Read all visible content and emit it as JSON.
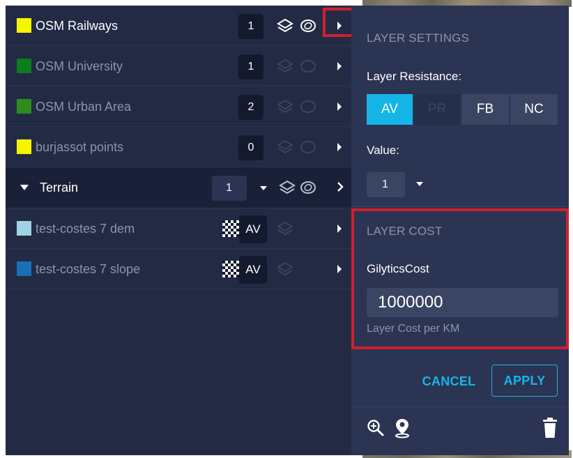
{
  "colors": {
    "accent": "#16b5e8",
    "panel_bg": "#2b3452",
    "list_bg": "#232a44",
    "highlight": "#d0202f"
  },
  "layers": [
    {
      "name": "OSM Railways",
      "color": "#f5f500",
      "count": "1",
      "active": true
    },
    {
      "name": "OSM University",
      "color": "#0e7d1e",
      "count": "1",
      "active": false
    },
    {
      "name": "OSM Urban Area",
      "color": "#2e8b1e",
      "count": "2",
      "active": false
    },
    {
      "name": "burjassot points",
      "color": "#f5f500",
      "count": "0",
      "active": false
    }
  ],
  "group": {
    "name": "Terrain",
    "value": "1"
  },
  "terrain_layers": [
    {
      "name": "test-costes 7 dem",
      "color": "#9ed3e6",
      "tag": "AV"
    },
    {
      "name": "test-costes 7 slope",
      "color": "#1a6fb5",
      "tag": "AV"
    }
  ],
  "settings": {
    "title": "LAYER SETTINGS",
    "resistance_label": "Layer Resistance:",
    "resistance_options": [
      "AV",
      "PR",
      "FB",
      "NC"
    ],
    "resistance_selected": "AV",
    "value_label": "Value:",
    "value": "1",
    "cost_title": "LAYER COST",
    "cost_name": "GilyticsCost",
    "cost_value": "1000000",
    "cost_hint": "Layer Cost per KM",
    "cancel_label": "CANCEL",
    "apply_label": "APPLY"
  },
  "icons": {
    "row_arrow": "chevron-right-icon",
    "stack": "layers-icon",
    "ring": "ring-icon",
    "zoom": "zoom-in-icon",
    "locate": "map-pin-icon",
    "delete": "trash-icon",
    "raster": "checkerboard-icon"
  }
}
